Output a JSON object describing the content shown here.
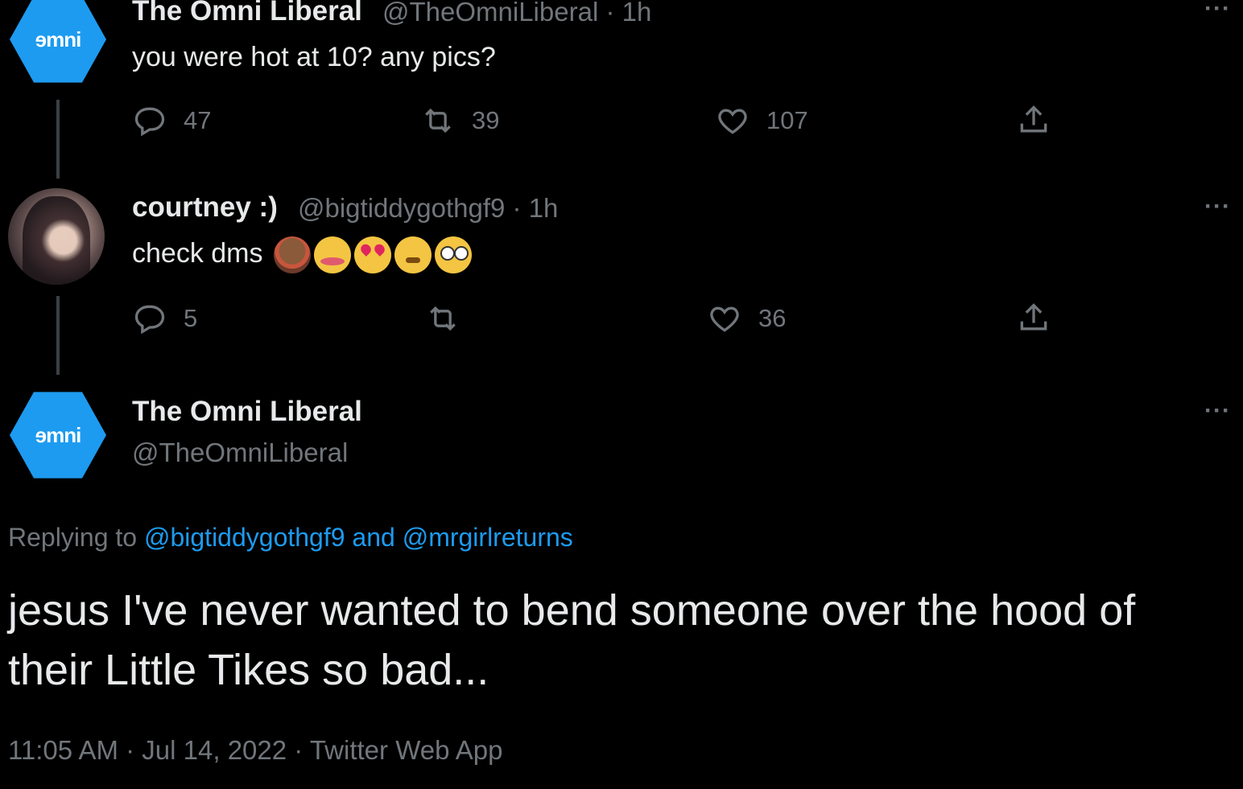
{
  "tweets": [
    {
      "avatar_text": "ɘmni",
      "name": "The Omni Liberal",
      "handle": "@TheOmniLiberal",
      "time": "· 1h",
      "text": "you were hot at 10? any pics?",
      "replies": "47",
      "retweets": "39",
      "likes": "107"
    },
    {
      "name": "courtney :)",
      "handle": "@bigtiddygothgf9",
      "time": "· 1h",
      "text": "check dms",
      "emojis": [
        "monkey-covering-eyes",
        "smiling-hearts",
        "heart-eyes",
        "relieved",
        "flushed"
      ],
      "replies": "5",
      "retweets": "",
      "likes": "36"
    }
  ],
  "main_tweet": {
    "avatar_text": "ɘmni",
    "name": "The Omni Liberal",
    "handle": "@TheOmniLiberal",
    "replying_prefix": "Replying to",
    "replying_user1": "@bigtiddygothgf9",
    "replying_and": "and",
    "replying_user2": "@mrgirlreturns",
    "text": "jesus I've never wanted to bend someone over the hood of their Little Tikes so bad...",
    "meta": "11:05 AM · Jul 14, 2022 · Twitter Web App"
  },
  "more_label": "···",
  "colors": {
    "background": "#000000",
    "accent": "#1d9bf0",
    "muted": "#71767b",
    "text": "#e7e9ea"
  }
}
